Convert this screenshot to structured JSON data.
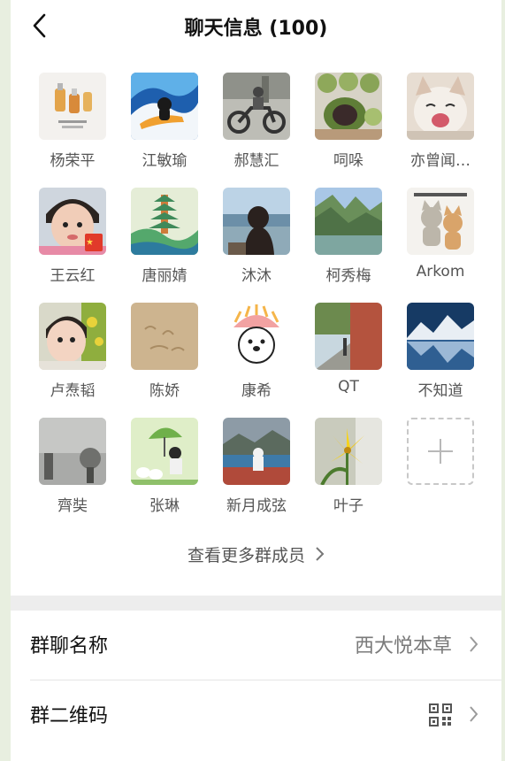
{
  "header": {
    "title": "聊天信息 (100)",
    "back_icon": "chevron-left-icon"
  },
  "members": [
    {
      "name": "杨荣平",
      "avatar": "product-bottles"
    },
    {
      "name": "江敏瑜",
      "avatar": "surfing-cat"
    },
    {
      "name": "郝慧汇",
      "avatar": "motorcycle"
    },
    {
      "name": "呞哚",
      "avatar": "green-rice-cakes"
    },
    {
      "name": "亦曾闻…",
      "avatar": "laughing-cat"
    },
    {
      "name": "王云红",
      "avatar": "baby-with-flag"
    },
    {
      "name": "唐丽婧",
      "avatar": "pagoda-painting"
    },
    {
      "name": "沐沐",
      "avatar": "girl-by-lake"
    },
    {
      "name": "柯秀梅",
      "avatar": "river-gorge"
    },
    {
      "name": "Arkom",
      "avatar": "cartoon-cats"
    },
    {
      "name": "卢焘韬",
      "avatar": "toddler-flowers"
    },
    {
      "name": "陈娇",
      "avatar": "sand-writing"
    },
    {
      "name": "康希",
      "avatar": "cartoon-dog"
    },
    {
      "name": "QT",
      "avatar": "street-wall"
    },
    {
      "name": "不知道",
      "avatar": "mountain-lake"
    },
    {
      "name": "齊奘",
      "avatar": "grey-flowers"
    },
    {
      "name": "张琳",
      "avatar": "girl-umbrella-ducks"
    },
    {
      "name": "新月成弦",
      "avatar": "lake-prayer"
    },
    {
      "name": "叶子",
      "avatar": "yellow-lily"
    }
  ],
  "add_member_icon": "plus-icon",
  "more_members_label": "查看更多群成员",
  "settings": {
    "group_name_label": "群聊名称",
    "group_name_value": "西大悦本草",
    "qr_label": "群二维码",
    "qr_icon": "qr-code-icon"
  },
  "colors": {
    "page_bg": "#e8efe0",
    "card_bg": "#ffffff",
    "divider": "#e5e5e5",
    "secondary_text": "#555555"
  }
}
